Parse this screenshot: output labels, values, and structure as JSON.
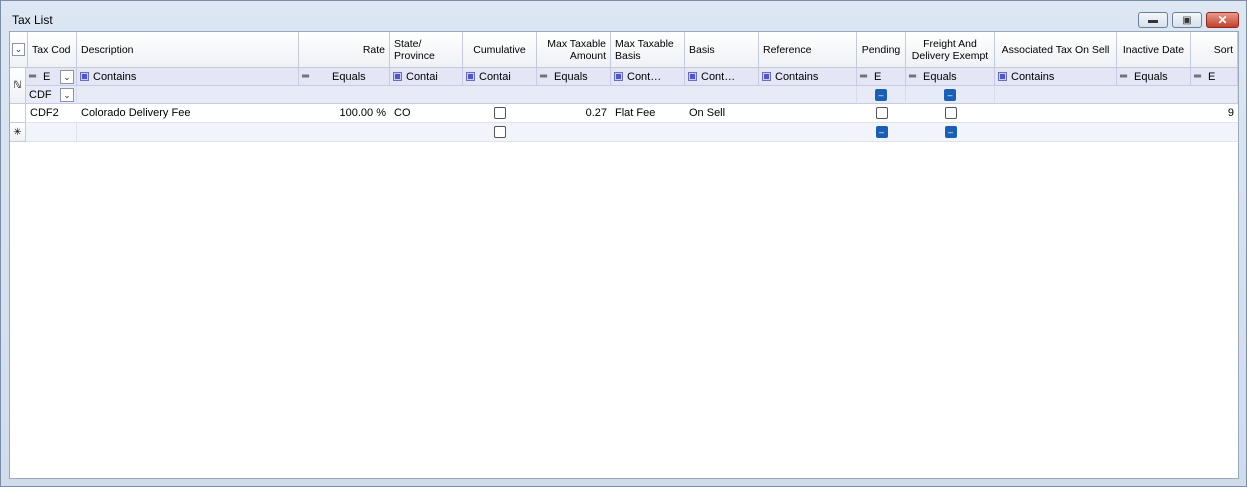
{
  "window": {
    "title": "Tax List",
    "minimize_icon": "minimize-icon",
    "maximize_icon": "maximize-icon",
    "close_icon": "close-icon"
  },
  "grid": {
    "header_menu_icon": "chevron-down-icon",
    "columns": [
      {
        "key": "tax_code",
        "label": "Tax Cod"
      },
      {
        "key": "description",
        "label": "Description"
      },
      {
        "key": "rate",
        "label": "Rate"
      },
      {
        "key": "state",
        "label": "State/ Province"
      },
      {
        "key": "cumulative",
        "label": "Cumulative"
      },
      {
        "key": "max_amount",
        "label": "Max Taxable Amount"
      },
      {
        "key": "max_basis",
        "label": "Max Taxable Basis"
      },
      {
        "key": "basis",
        "label": "Basis"
      },
      {
        "key": "reference",
        "label": "Reference"
      },
      {
        "key": "pending",
        "label": "Pending"
      },
      {
        "key": "freight",
        "label": "Freight And Delivery Exempt"
      },
      {
        "key": "assoc_tax",
        "label": "Associated Tax On Sell"
      },
      {
        "key": "inactive",
        "label": "Inactive Date"
      },
      {
        "key": "sort",
        "label": "Sort"
      }
    ],
    "filters": {
      "row_icon": "filter-row-icon",
      "tax_code": "E",
      "description": "Contains",
      "rate": "Equals",
      "state": "Contai",
      "cumulative": "Contai",
      "max_amount": "Equals",
      "max_basis": "Cont…",
      "basis": "Cont…",
      "reference": "Contains",
      "pending": "E",
      "freight": "Equals",
      "assoc_tax": "Contains",
      "inactive": "Equals",
      "sort": "E"
    },
    "filter_values": {
      "tax_code": "CDF"
    },
    "rows": [
      {
        "tax_code": "CDF2",
        "description": "Colorado Delivery Fee",
        "rate": "100.00 %",
        "state": "CO",
        "max_amount": "0.27",
        "max_basis": "Flat Fee",
        "basis": "On Sell",
        "reference": "",
        "assoc_tax": "",
        "inactive": "",
        "sort": "9"
      }
    ],
    "new_row_marker": "✳"
  }
}
